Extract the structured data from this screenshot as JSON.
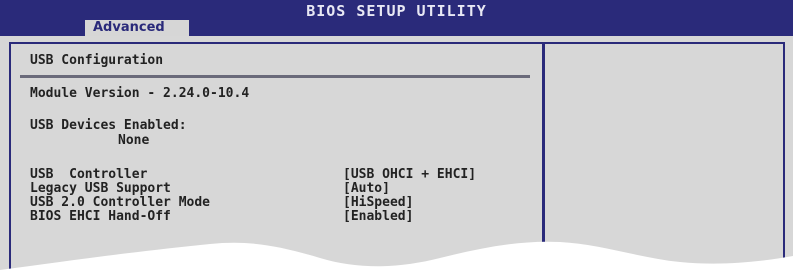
{
  "header": {
    "title": "BIOS SETUP UTILITY",
    "tab": "Advanced"
  },
  "section": {
    "title": "USB Configuration"
  },
  "info": {
    "module_version": "Module Version - 2.24.0-10.4",
    "devices_label": "USB Devices Enabled:",
    "devices_value": "None"
  },
  "settings": [
    {
      "label": "USB  Controller",
      "value": "[USB OHCI + EHCI]"
    },
    {
      "label": "Legacy USB Support",
      "value": "[Auto]"
    },
    {
      "label": "USB 2.0 Controller Mode",
      "value": "[HiSpeed]"
    },
    {
      "label": "BIOS EHCI Hand-Off",
      "value": "[Enabled]"
    }
  ],
  "colors": {
    "frame": "#2a2a7a",
    "panel": "#d7d7d7",
    "tab_text": "#2a2a7a"
  }
}
